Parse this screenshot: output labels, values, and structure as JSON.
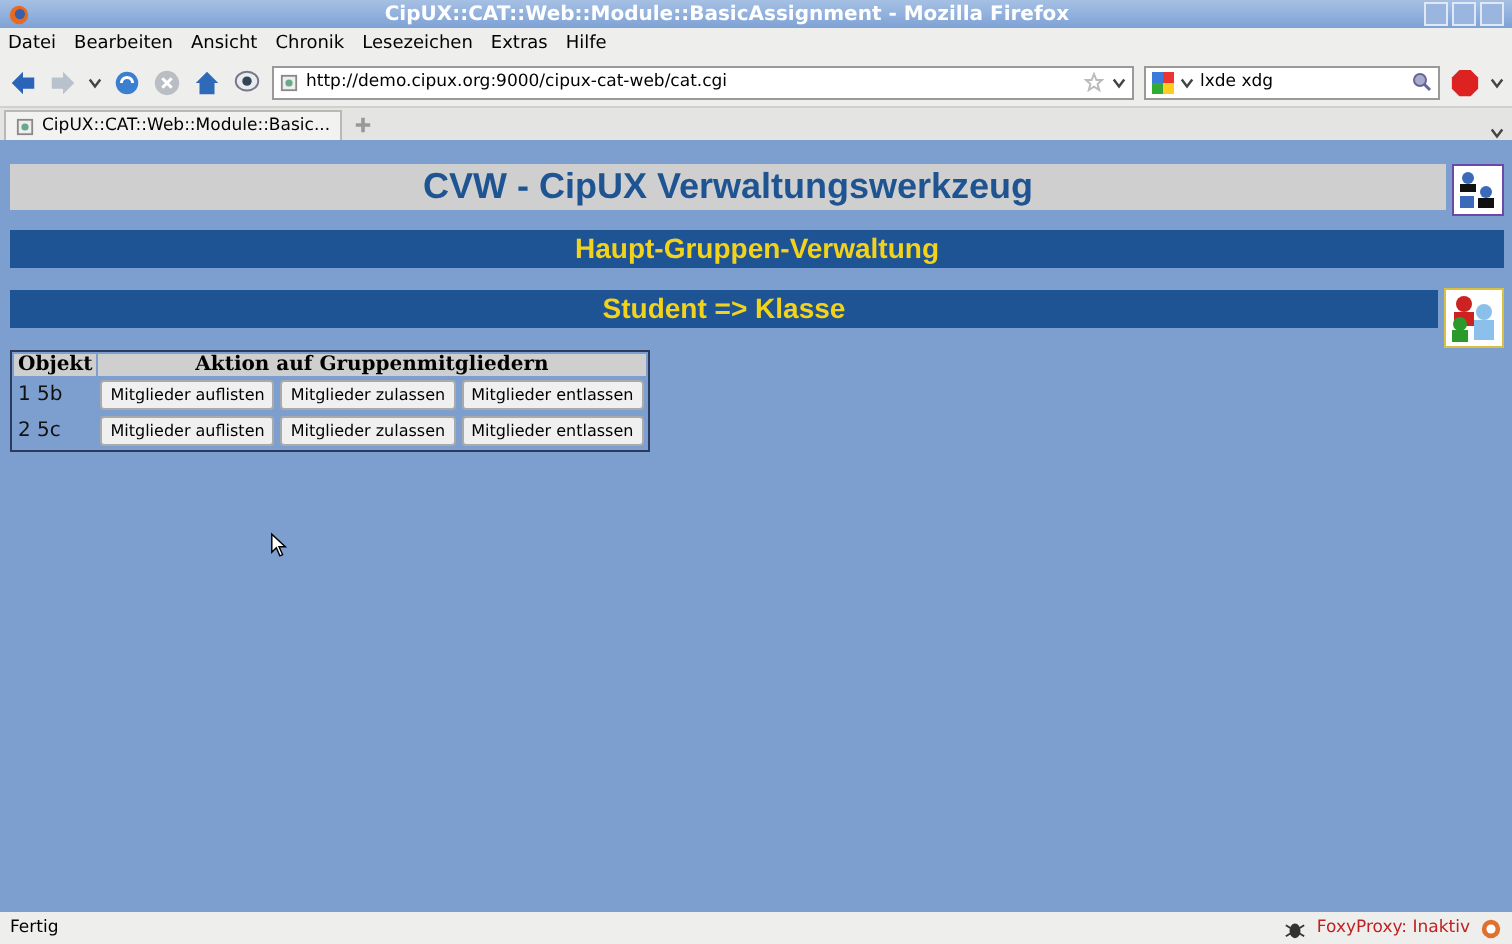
{
  "window": {
    "title": "CipUX::CAT::Web::Module::BasicAssignment - Mozilla Firefox"
  },
  "menu": [
    "Datei",
    "Bearbeiten",
    "Ansicht",
    "Chronik",
    "Lesezeichen",
    "Extras",
    "Hilfe"
  ],
  "address": {
    "value": "http://demo.cipux.org:9000/cipux-cat-web/cat.cgi"
  },
  "search": {
    "value": "lxde xdg"
  },
  "tabs": [
    {
      "label": "CipUX::CAT::Web::Module::Basic...",
      "selected": true
    }
  ],
  "page": {
    "title": "CVW - CipUX Verwaltungswerkzeug",
    "section": "Haupt-Gruppen-Verwaltung",
    "subsection": "Student => Klasse",
    "table": {
      "columns": [
        "Objekt",
        "Aktion auf Gruppenmitgliedern"
      ],
      "rows": [
        {
          "object": "1 5b",
          "actions": [
            "Mitglieder auflisten",
            "Mitglieder zulassen",
            "Mitglieder entlassen"
          ]
        },
        {
          "object": "2 5c",
          "actions": [
            "Mitglieder auflisten",
            "Mitglieder zulassen",
            "Mitglieder entlassen"
          ]
        }
      ]
    }
  },
  "status_bar": {
    "text": "Fertig",
    "proxy": "FoxyProxy: Inaktiv"
  }
}
